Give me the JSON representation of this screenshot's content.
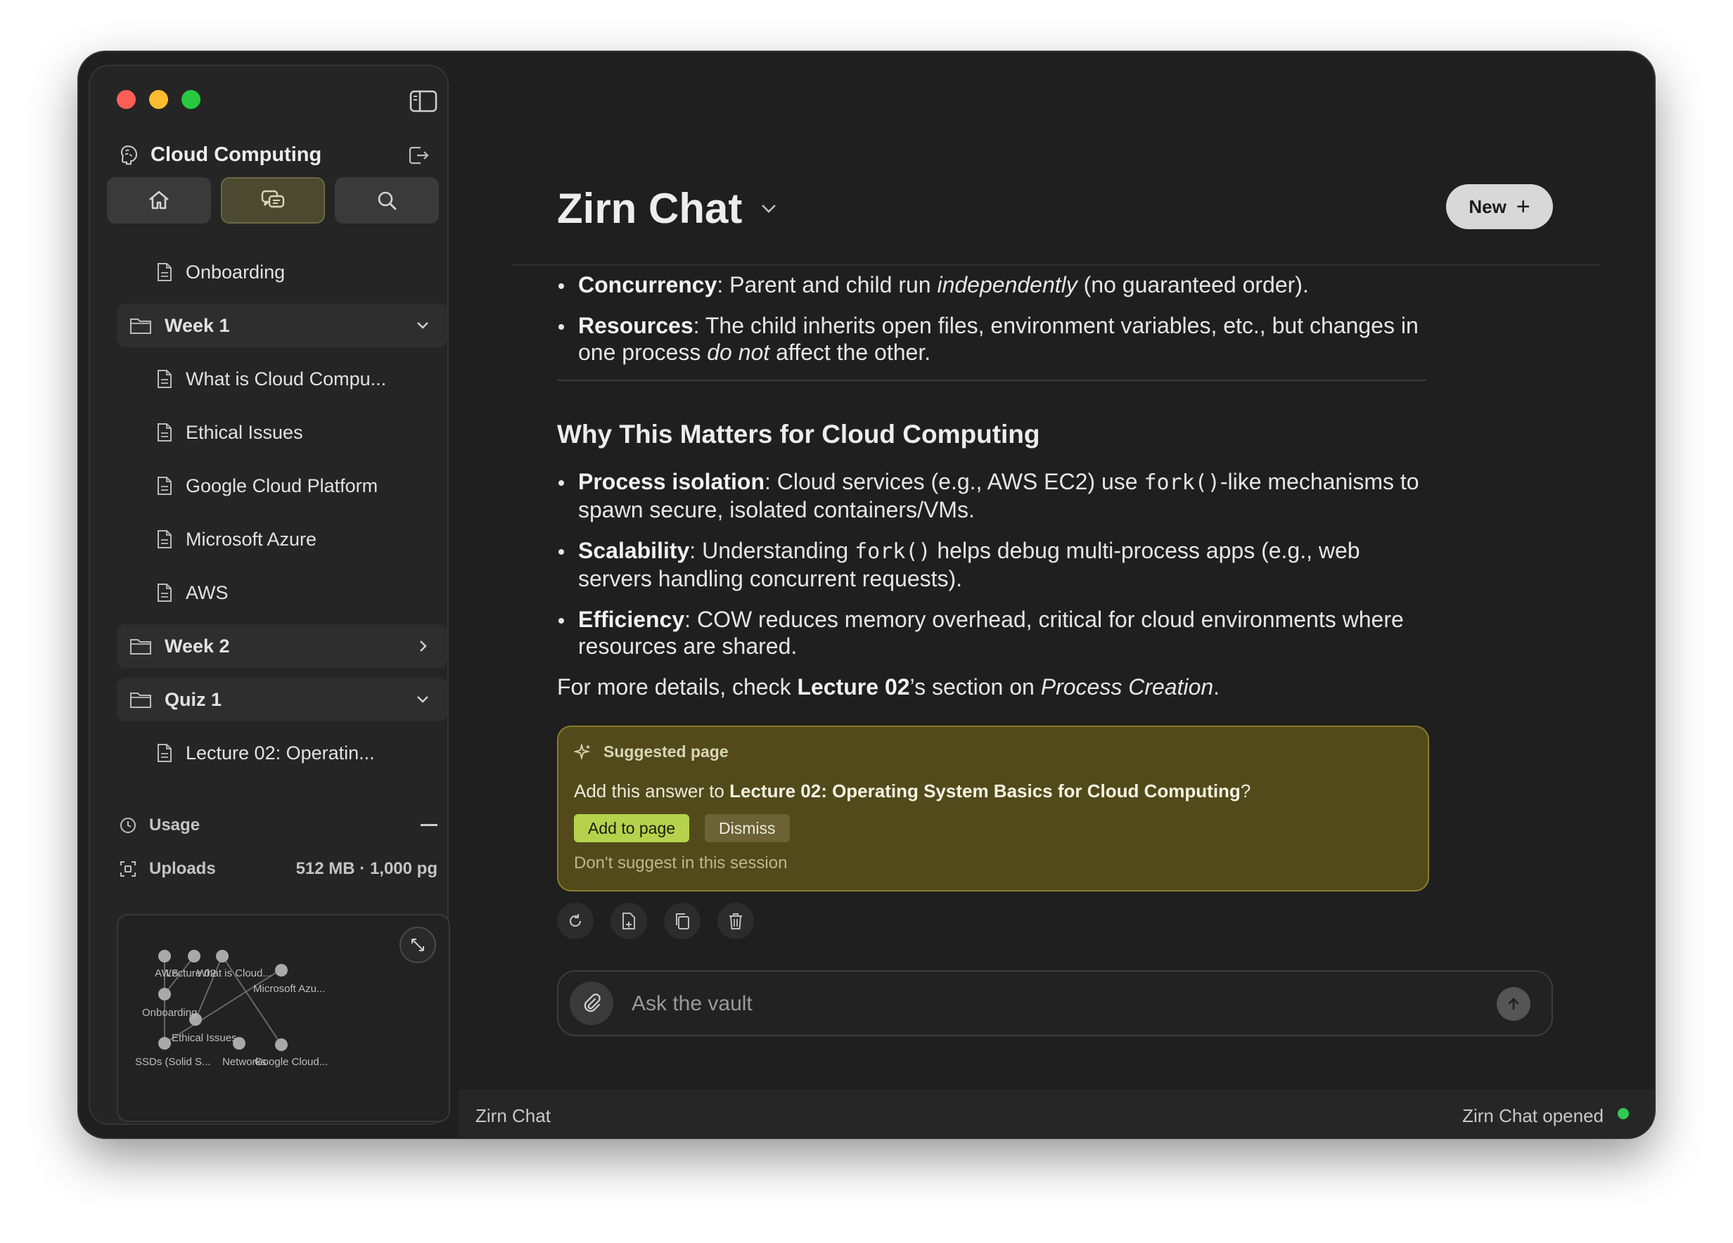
{
  "sidebar": {
    "title": "Cloud Computing",
    "nav": {
      "home_icon": "home-icon",
      "chat_icon": "chat-icon",
      "search_icon": "search-icon",
      "active": "chat"
    },
    "items": [
      {
        "type": "doc",
        "label": "Onboarding"
      },
      {
        "type": "folder",
        "label": "Week 1",
        "expanded": true
      },
      {
        "type": "doc",
        "label": "What is Cloud Compu..."
      },
      {
        "type": "doc",
        "label": "Ethical Issues"
      },
      {
        "type": "doc",
        "label": "Google Cloud Platform"
      },
      {
        "type": "doc",
        "label": "Microsoft Azure"
      },
      {
        "type": "doc",
        "label": "AWS"
      },
      {
        "type": "folder",
        "label": "Week 2",
        "expanded": false
      },
      {
        "type": "folder",
        "label": "Quiz 1",
        "expanded": true
      },
      {
        "type": "doc",
        "label": "Lecture 02: Operatin..."
      }
    ],
    "usage_label": "Usage",
    "uploads_label": "Uploads",
    "uploads_value": "512 MB · 1,000 pg",
    "graph": {
      "labels": [
        "AWS",
        "Lecture 02",
        "What is Cloud...",
        "Microsoft Azu...",
        "Onboarding",
        "Ethical Issues",
        "SSDs (Solid S...",
        "Networks",
        "Google Cloud..."
      ]
    }
  },
  "main": {
    "title": "Zirn Chat",
    "new_button": "New",
    "message": {
      "bullets_top": [
        {
          "term": "Concurrency",
          "before": ": Parent and child run ",
          "em": "independently",
          "after": " (no guaranteed order)."
        },
        {
          "term": "Resources",
          "before": ": The child inherits open files, environment variables, etc., but changes in one process ",
          "em": "do not",
          "after": " affect the other."
        }
      ],
      "heading": "Why This Matters for Cloud Computing",
      "bullets": [
        {
          "term": "Process isolation",
          "before": ": Cloud services (e.g., AWS EC2) use ",
          "code": "fork()",
          "after": "-like mechanisms to spawn secure, isolated containers/VMs."
        },
        {
          "term": "Scalability",
          "before": ": Understanding ",
          "code": "fork()",
          "after": " helps debug multi-process apps (e.g., web servers handling concurrent requests)."
        },
        {
          "term": "Efficiency",
          "before": ": COW reduces memory overhead, critical for cloud environments where resources are shared."
        }
      ],
      "closing": {
        "before": "For more details, check ",
        "bold": "Lecture 02",
        "middle": "’s section on ",
        "em": "Process Creation",
        "after": "."
      }
    },
    "suggestion": {
      "header": "Suggested page",
      "prefix": "Add this answer to ",
      "page": "Lecture 02: Operating System Basics for Cloud Computing",
      "suffix": "?",
      "add_label": "Add to page",
      "dismiss_label": "Dismiss",
      "dont_suggest": "Don't suggest in this session"
    },
    "actions": [
      "regenerate-icon",
      "save-to-page-icon",
      "copy-icon",
      "delete-icon"
    ],
    "composer": {
      "placeholder": "Ask the vault"
    }
  },
  "statusbar": {
    "left": "Zirn Chat",
    "right": "Zirn Chat opened",
    "status_color": "#30c94f"
  },
  "colors": {
    "suggestion_bg": "#524a1b",
    "add_button": "#b6d24c",
    "accent_active_nav": "#4b4a30"
  }
}
